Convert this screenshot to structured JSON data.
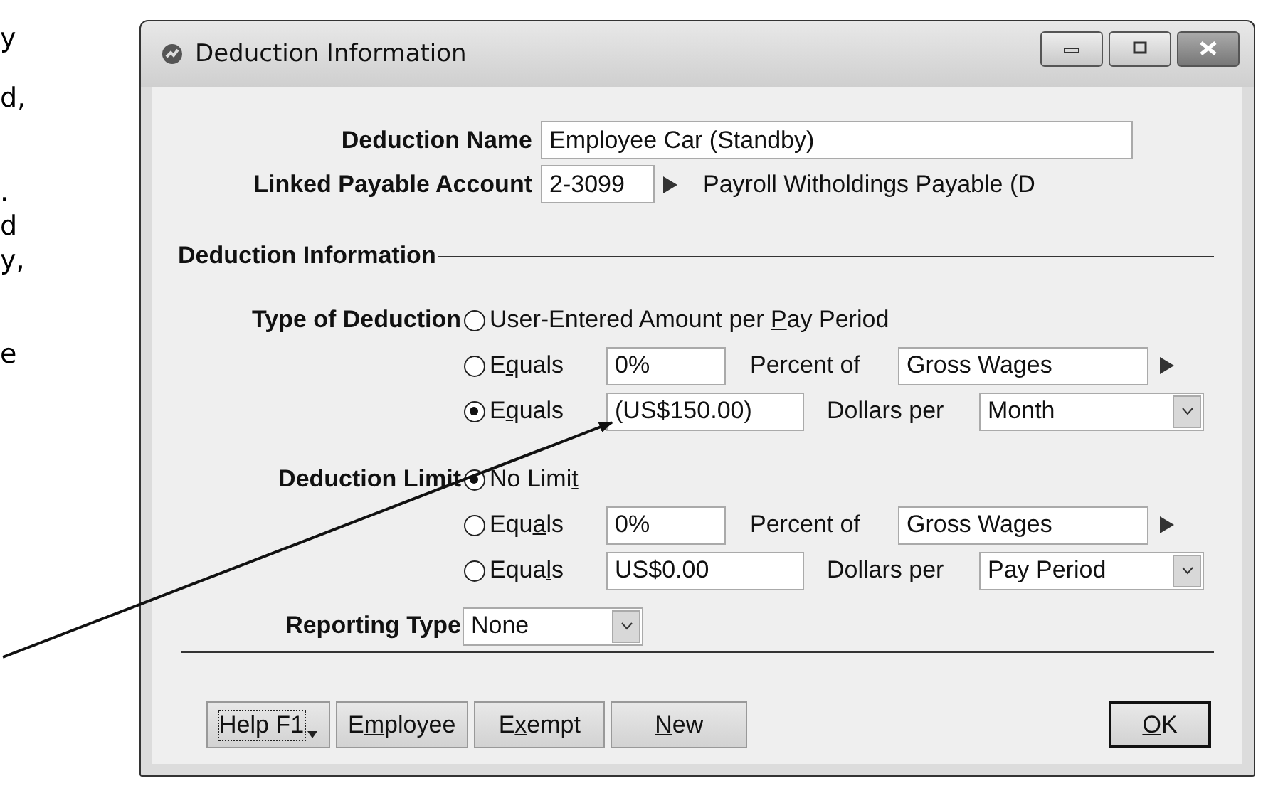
{
  "page_text_fragments": [
    "y",
    "d,",
    ".",
    "d",
    "y,",
    "e"
  ],
  "window": {
    "title": "Deduction Information"
  },
  "deduction_name": {
    "label": "Deduction Name",
    "value": "Employee Car (Standby)"
  },
  "linked_payable_account": {
    "label": "Linked Payable Account",
    "value": "2-3099",
    "account_name": "Payroll Witholdings Payable (D"
  },
  "section": {
    "title": "Deduction Information"
  },
  "type_of_deduction": {
    "label": "Type of Deduction",
    "options": [
      {
        "kind": "plain",
        "label_parts": {
          "before": "User-Entered Amount per ",
          "key": "P",
          "after": "ay Period"
        },
        "selected": false
      },
      {
        "kind": "percent",
        "label_parts": {
          "before": "E",
          "key": "q",
          "after": "uals"
        },
        "selected": false,
        "value": "0%",
        "unit_label": "Percent of",
        "basis": "Gross Wages"
      },
      {
        "kind": "dollars",
        "label_parts": {
          "before": "E",
          "key": "q",
          "after": "uals"
        },
        "selected": true,
        "value": "(US$150.00)",
        "unit_label": "Dollars per",
        "period": "Month"
      }
    ]
  },
  "deduction_limit": {
    "label": "Deduction Limit",
    "options": [
      {
        "kind": "plain",
        "label_parts": {
          "before": "No Limi",
          "key": "t"
        },
        "selected": true
      },
      {
        "kind": "percent",
        "label_parts": {
          "before": "Equ",
          "key": "a",
          "after": "ls"
        },
        "selected": false,
        "value": "0%",
        "unit_label": "Percent of",
        "basis": "Gross Wages"
      },
      {
        "kind": "dollars",
        "label_parts": {
          "before": "Equa",
          "key": "l",
          "after": "s"
        },
        "selected": false,
        "value": "US$0.00",
        "unit_label": "Dollars per",
        "period": "Pay Period"
      }
    ]
  },
  "reporting_type": {
    "label": "Reporting Type",
    "value": "None"
  },
  "buttons": [
    {
      "kind": "menu",
      "label_parts": {
        "before": "Help F1"
      },
      "focused": true
    },
    {
      "kind": "plain",
      "label_parts": {
        "before": "E",
        "key": "m",
        "after": "ployee"
      },
      "focused": false
    },
    {
      "kind": "plain",
      "label_parts": {
        "before": "E",
        "key": "x",
        "after": "empt"
      },
      "focused": false
    },
    {
      "kind": "plain",
      "label_parts": {
        "key": "N",
        "after": "ew"
      },
      "focused": false
    },
    {
      "kind": "default",
      "label_parts": {
        "key": "O",
        "after": "K"
      },
      "focused": false
    }
  ]
}
